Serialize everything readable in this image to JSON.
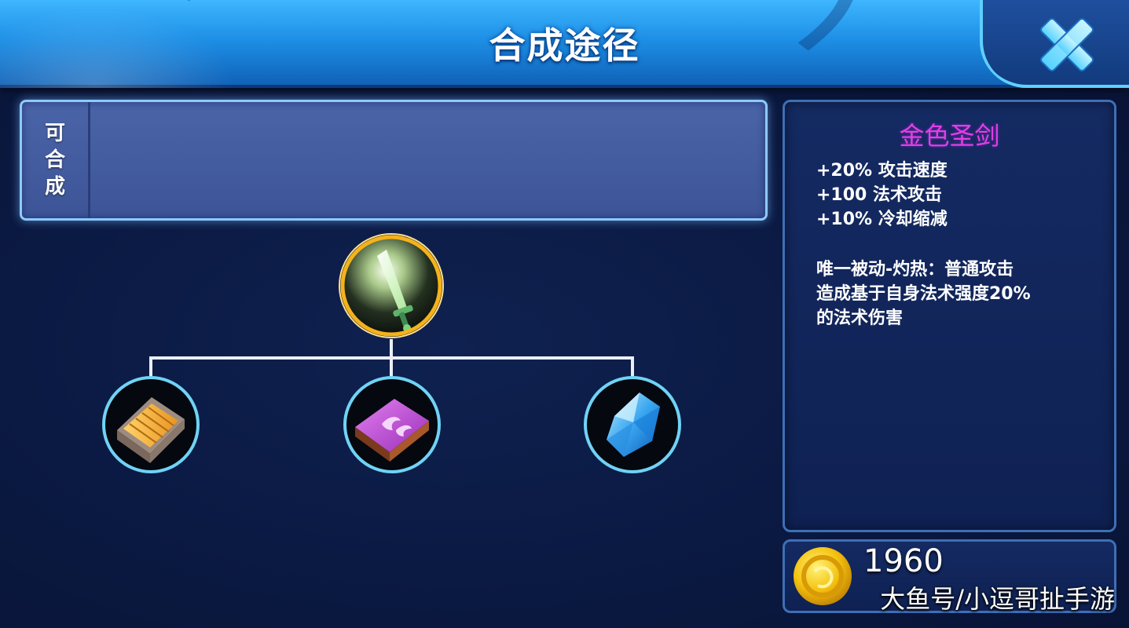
{
  "header": {
    "title": "合成途径"
  },
  "craftable": {
    "label_chars": [
      "可",
      "合",
      "成"
    ]
  },
  "tree": {
    "root": {
      "icon": "golden-sword-icon"
    },
    "components": [
      {
        "icon": "wooden-crate-icon"
      },
      {
        "icon": "purple-spellbook-icon"
      },
      {
        "icon": "blue-crystal-icon"
      }
    ]
  },
  "item": {
    "name": "金色圣剑",
    "stats": [
      "+20% 攻击速度",
      "+100 法术攻击",
      "+10% 冷却缩减"
    ],
    "passive_lines": [
      "唯一被动-灼热：普通攻击",
      "造成基于自身法术强度20%",
      "的法术伤害"
    ]
  },
  "price": {
    "value": "1960",
    "icon": "gold-coin-icon"
  },
  "watermark": "大鱼号/小逗哥扯手游",
  "colors": {
    "item_name": "#e23ee8",
    "header": "#1d8fe6",
    "root_ring": "#f5b21a",
    "child_ring": "#6fd3f5"
  }
}
